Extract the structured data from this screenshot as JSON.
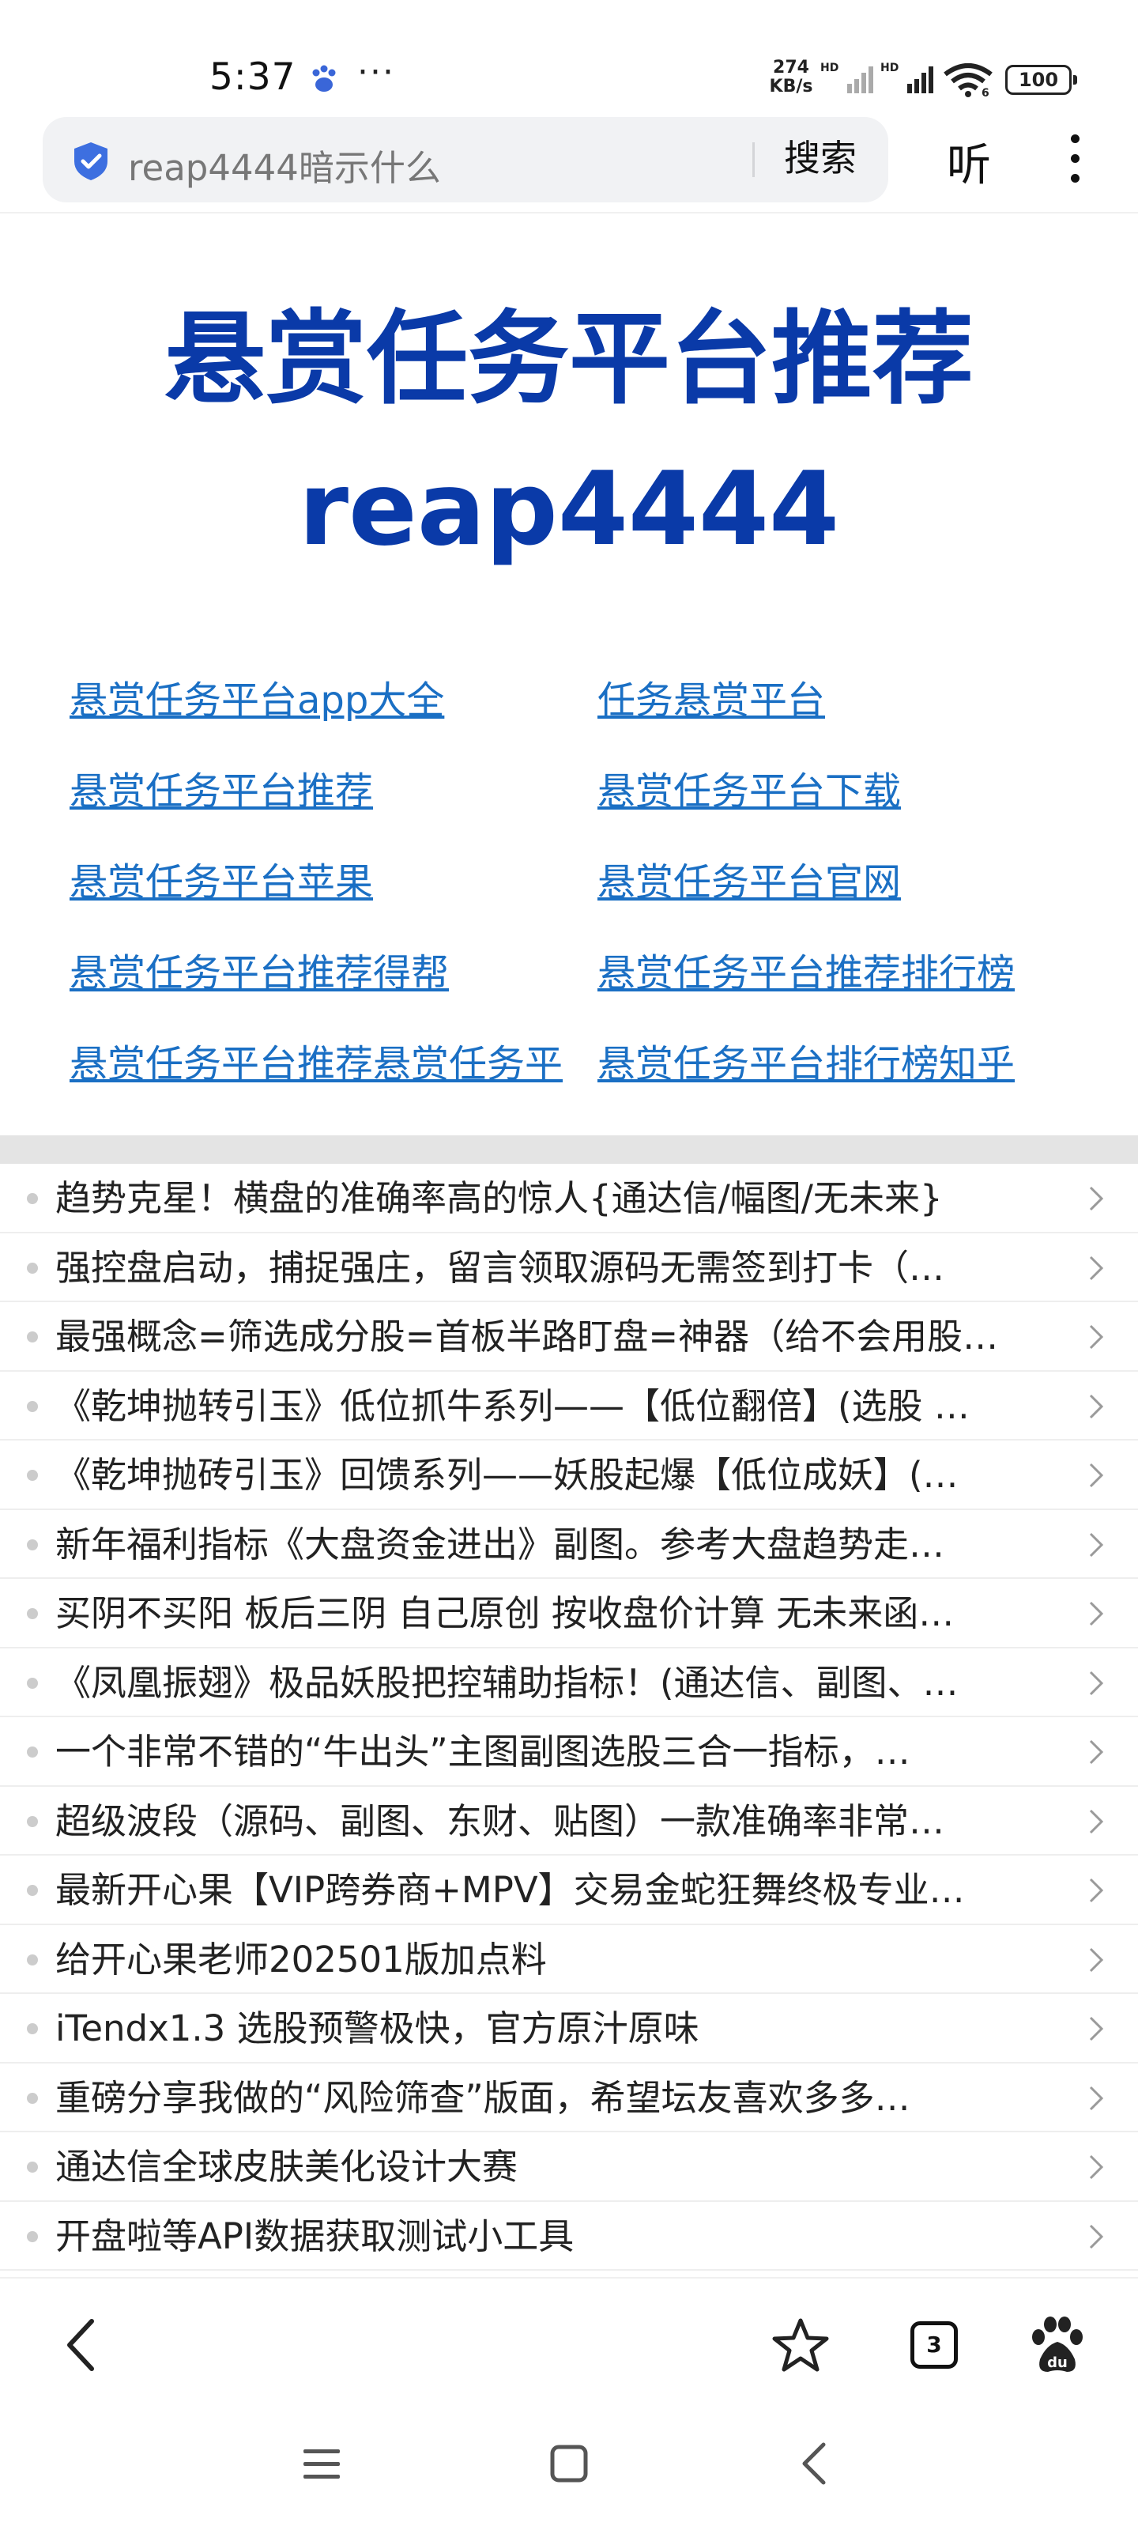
{
  "status_bar": {
    "time": "5:37",
    "dots": "···",
    "net_speed_value": "274",
    "net_speed_unit": "KB/s",
    "signal_label_1": "HD",
    "signal_label_2": "HD",
    "wifi_label": "6",
    "battery": "100"
  },
  "browser": {
    "search_text": "reap4444暗示什么",
    "search_button": "搜索",
    "listen_button": "听",
    "tab_count": "3"
  },
  "page": {
    "title_line1": "悬赏任务平台推荐",
    "title_line2": "reap4444",
    "links": [
      "悬赏任务平台app大全",
      "任务悬赏平台",
      "悬赏任务平台推荐",
      "悬赏任务平台下载",
      "悬赏任务平台苹果",
      "悬赏任务平台官网",
      "悬赏任务平台推荐得帮",
      "悬赏任务平台推荐排行榜",
      "悬赏任务平台推荐悬赏任务平",
      "悬赏任务平台排行榜知乎"
    ],
    "news": [
      "趋势克星！横盘的准确率高的惊人{通达信/幅图/无未来}",
      "强控盘启动，捕捉强庄，留言领取源码无需签到打卡（…",
      "最强概念=筛选成分股=首板半路盯盘=神器（给不会用股…",
      "《乾坤抛转引玉》低位抓牛系列——【低位翻倍】(选股 …",
      "《乾坤抛砖引玉》回馈系列——妖股起爆【低位成妖】(…",
      "新年福利指标《大盘资金进出》副图。参考大盘趋势走…",
      "买阴不买阳 板后三阴 自己原创 按收盘价计算 无未来函…",
      "《凤凰振翅》极品妖股把控辅助指标！(通达信、副图、…",
      "一个非常不错的“牛出头”主图副图选股三合一指标，…",
      "超级波段（源码、副图、东财、贴图）一款准确率非常…",
      "最新开心果【VIP跨券商+MPV】交易金蛇狂舞终极专业…",
      "给开心果老师202501版加点料",
      "iTendx1.3 选股预警极快，官方原汁原味",
      "重磅分享我做的“风险筛查”版面，希望坛友喜欢多多…",
      "通达信全球皮肤美化设计大赛",
      "开盘啦等API数据获取测试小工具"
    ]
  },
  "colors": {
    "title_blue": "#0a3aa8",
    "link_blue": "#1a6fc4",
    "shield_blue": "#3d6fe0"
  }
}
